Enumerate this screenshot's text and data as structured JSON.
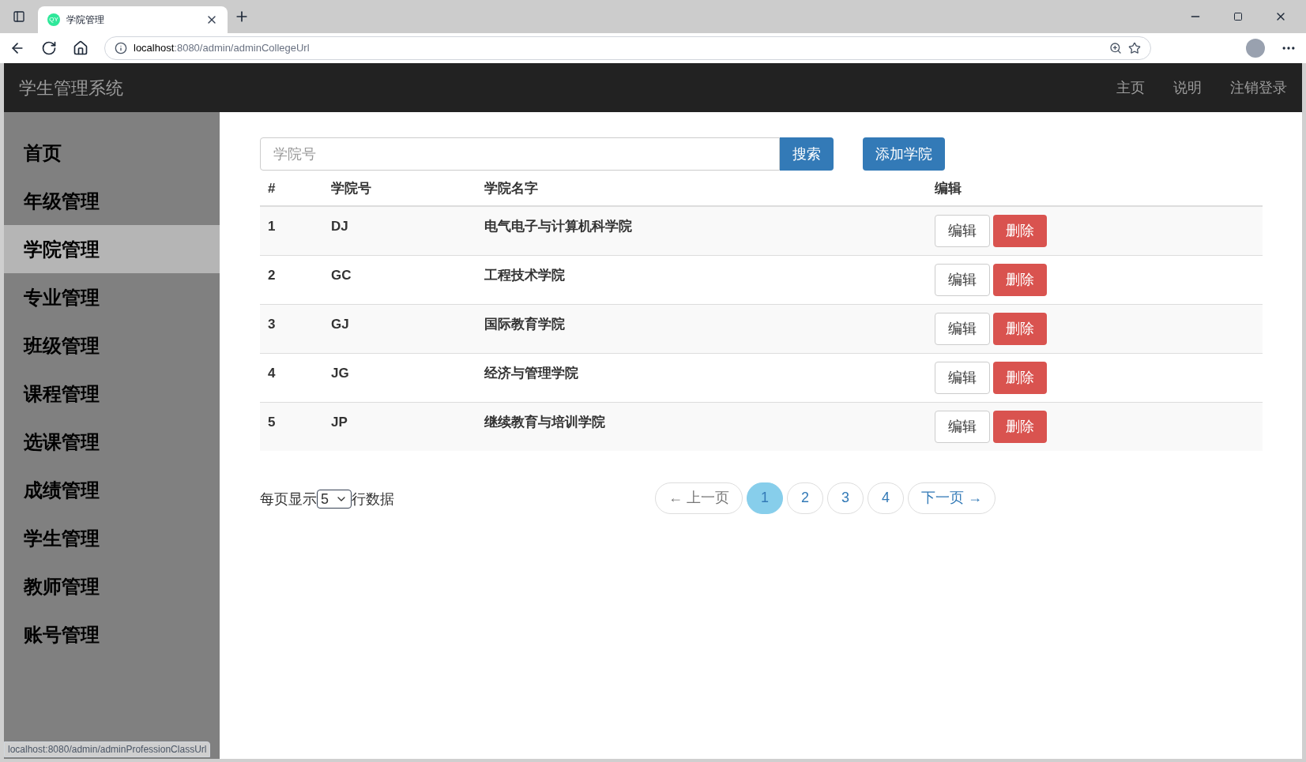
{
  "browser": {
    "tab_title": "学院管理",
    "tab_icon_text": "QY",
    "url_host": "localhost",
    "url_path": ":8080/admin/adminCollegeUrl",
    "status_url": "localhost:8080/admin/adminProfessionClassUrl"
  },
  "navbar": {
    "brand": "学生管理系统",
    "links": [
      "主页",
      "说明",
      "注销登录"
    ]
  },
  "sidebar": {
    "items": [
      {
        "label": "首页",
        "selected": false
      },
      {
        "label": "年级管理",
        "selected": false
      },
      {
        "label": "学院管理",
        "selected": true
      },
      {
        "label": "专业管理",
        "selected": false
      },
      {
        "label": "班级管理",
        "selected": false
      },
      {
        "label": "课程管理",
        "selected": false
      },
      {
        "label": "选课管理",
        "selected": false
      },
      {
        "label": "成绩管理",
        "selected": false
      },
      {
        "label": "学生管理",
        "selected": false
      },
      {
        "label": "教师管理",
        "selected": false
      },
      {
        "label": "账号管理",
        "selected": false
      }
    ]
  },
  "search": {
    "placeholder": "学院号",
    "button": "搜索",
    "add_button": "添加学院"
  },
  "table": {
    "columns": [
      "#",
      "学院号",
      "学院名字",
      "编辑"
    ],
    "rows": [
      {
        "cells": [
          "1",
          "DJ",
          "电气电子与计算机科学院"
        ],
        "edit": "编辑",
        "delete": "删除"
      },
      {
        "cells": [
          "2",
          "GC",
          "工程技术学院"
        ],
        "edit": "编辑",
        "delete": "删除"
      },
      {
        "cells": [
          "3",
          "GJ",
          "国际教育学院"
        ],
        "edit": "编辑",
        "delete": "删除"
      },
      {
        "cells": [
          "4",
          "JG",
          "经济与管理学院"
        ],
        "edit": "编辑",
        "delete": "删除"
      },
      {
        "cells": [
          "5",
          "JP",
          "继续教育与培训学院"
        ],
        "edit": "编辑",
        "delete": "删除"
      }
    ]
  },
  "page_size": {
    "before": "每页显示",
    "value": "5",
    "after": "行数据"
  },
  "pagination": {
    "prev": {
      "label": "← 上一页",
      "disabled": true
    },
    "pages": [
      {
        "label": "1",
        "selected": true
      },
      {
        "label": "2",
        "selected": false
      },
      {
        "label": "3",
        "selected": false
      },
      {
        "label": "4",
        "selected": false
      }
    ],
    "next": {
      "label": "下一页 →",
      "disabled": false
    }
  }
}
